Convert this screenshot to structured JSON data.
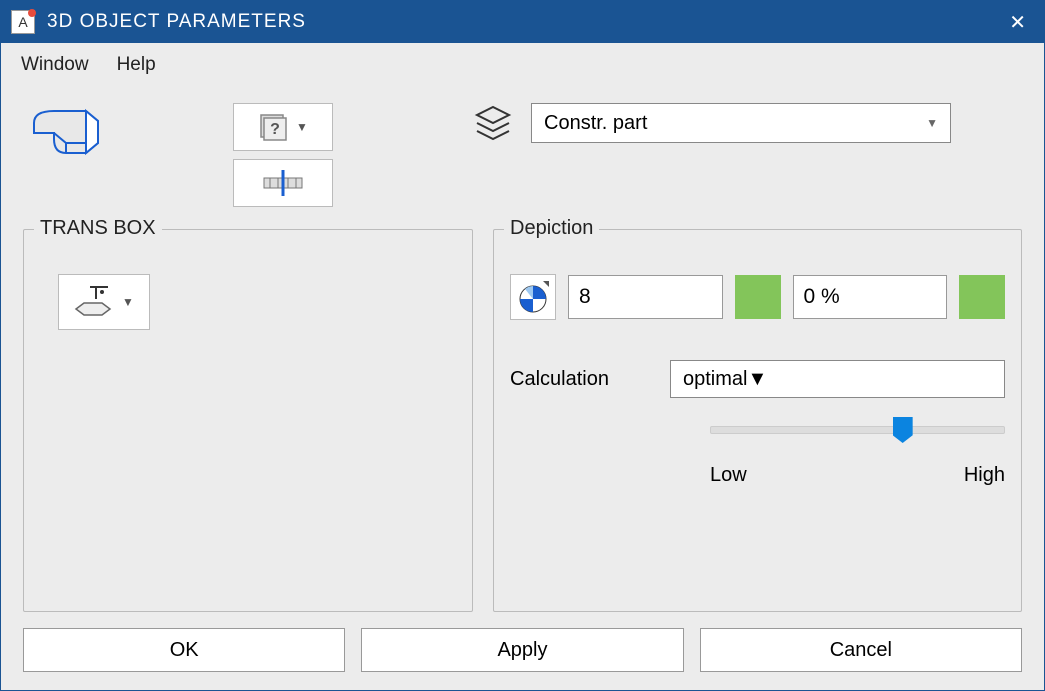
{
  "title": "3D OBJECT PARAMETERS",
  "app_icon_char": "A",
  "menu": {
    "window": "Window",
    "help": "Help"
  },
  "layer_select": {
    "value": "Constr. part"
  },
  "panels": {
    "trans": {
      "label": "TRANS BOX"
    },
    "depiction": {
      "label": "Depiction",
      "value1": "8",
      "value2": "0 %",
      "calc_label": "Calculation",
      "calc_value": "optimal",
      "slider_low": "Low",
      "slider_high": "High"
    }
  },
  "footer": {
    "ok": "OK",
    "apply": "Apply",
    "cancel": "Cancel"
  }
}
